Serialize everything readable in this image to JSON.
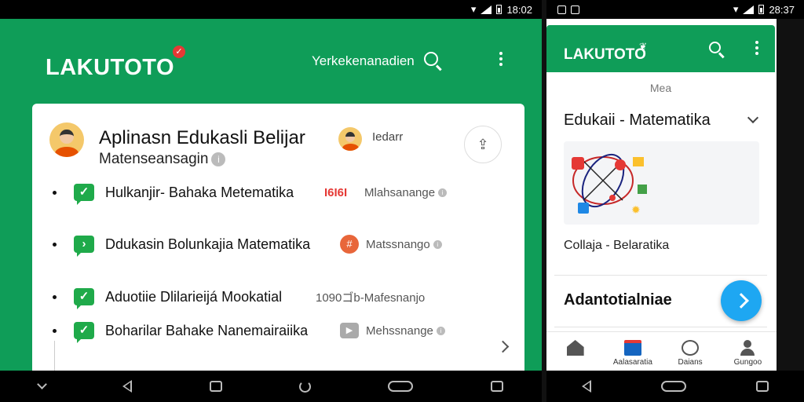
{
  "left": {
    "status": {
      "time": "18:02"
    },
    "header": {
      "logo": "LAKUTOTO",
      "link": "Yerkekenanadien"
    },
    "card": {
      "title": "Aplinasn Edukasli Belijar",
      "subtitle": "Matenseansagin",
      "user": "Iedarr",
      "items": [
        {
          "label": "Hulkanjir- Bahaka Metematika",
          "tag": "Ι6Ι6Ι",
          "meta": "Mlahsanange"
        },
        {
          "label": "Ddukasin Bolunkajia Matematika",
          "meta": "Matssnango"
        },
        {
          "label": "Aduotiie Dlilarieijá Mookatial",
          "meta": "1090ゴb-Mafesnanjo"
        },
        {
          "label": "Boharilar Bahake Nanemairaiika",
          "meta": "Mehssnange"
        }
      ]
    },
    "colors": {
      "brand": "#0f9d58",
      "check": "#1faa4a",
      "tag": "#e53935"
    }
  },
  "right": {
    "status": {
      "time": "28:37"
    },
    "header": {
      "logo": "LAKUTOTO"
    },
    "tab": "Mea",
    "section_title": "Edukaii - Matematika",
    "caption": "Collaja - Belaratika",
    "title2": "Adantotialniae",
    "bottom_nav": [
      {
        "label": "",
        "icon": "home-icon"
      },
      {
        "label": "Aalasaratia",
        "icon": "book-icon"
      },
      {
        "label": "Daians",
        "icon": "chat-icon"
      },
      {
        "label": "Gungoo",
        "icon": "user-icon"
      }
    ],
    "colors": {
      "fab": "#1ea7f2"
    }
  }
}
